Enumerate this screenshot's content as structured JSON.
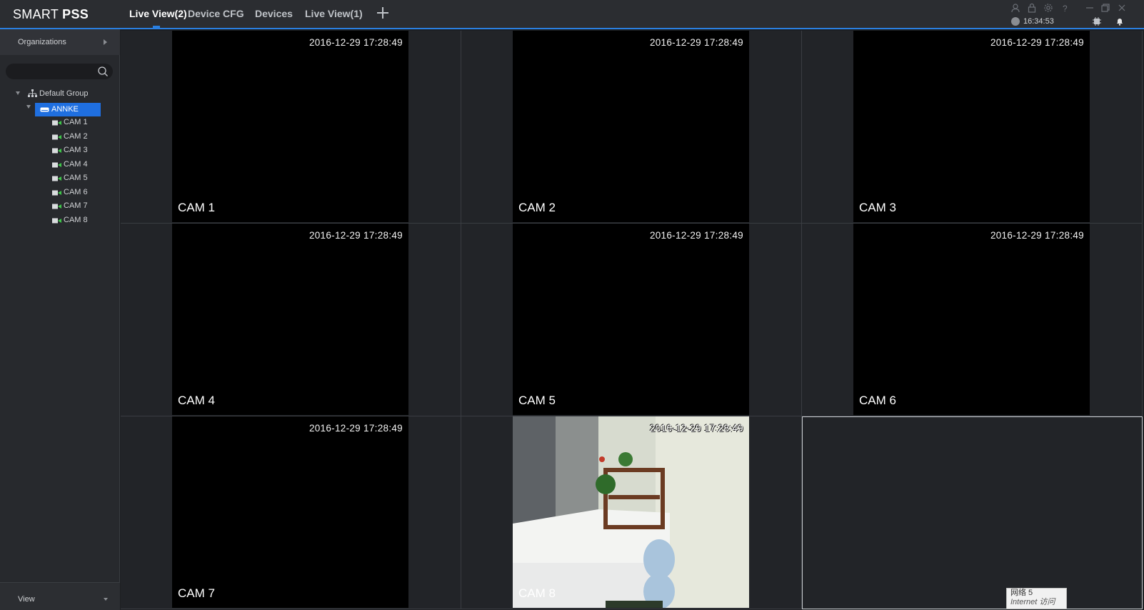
{
  "app": {
    "brand_light": "SMART ",
    "brand_bold": "PSS",
    "clock": "16:34:53"
  },
  "tabs": [
    {
      "label": "Live View(2)",
      "active": true
    },
    {
      "label": "Device CFG",
      "active": false
    },
    {
      "label": "Devices",
      "active": false
    },
    {
      "label": "Live View(1)",
      "active": false
    }
  ],
  "titlebar_icons": [
    "user-icon",
    "lock-icon",
    "settings-icon",
    "help-icon",
    "minimize-icon",
    "restore-icon",
    "close-icon"
  ],
  "sidebar": {
    "organizations_label": "Organizations",
    "search": {
      "placeholder": "",
      "value": ""
    },
    "tree": {
      "group": "Default Group",
      "device": "ANNKE",
      "channels": [
        "CAM 1",
        "CAM 2",
        "CAM 3",
        "CAM 4",
        "CAM 5",
        "CAM 6",
        "CAM 7",
        "CAM 8"
      ]
    },
    "view_label": "View"
  },
  "grid": {
    "cells": [
      {
        "camera": "CAM 1",
        "timestamp": "2016-12-29  17:28:49",
        "feed": "black"
      },
      {
        "camera": "CAM 2",
        "timestamp": "2016-12-29  17:28:49",
        "feed": "black"
      },
      {
        "camera": "CAM 3",
        "timestamp": "2016-12-29  17:28:49",
        "feed": "black"
      },
      {
        "camera": "CAM 4",
        "timestamp": "2016-12-29  17:28:49",
        "feed": "black"
      },
      {
        "camera": "CAM 5",
        "timestamp": "2016-12-29  17:28:49",
        "feed": "black"
      },
      {
        "camera": "CAM 6",
        "timestamp": "2016-12-29  17:28:49",
        "feed": "black"
      },
      {
        "camera": "CAM 7",
        "timestamp": "2016-12-29  17:28:49",
        "feed": "black"
      },
      {
        "camera": "CAM 8",
        "timestamp": "2016-12-29  17:28:49",
        "feed": "live"
      },
      {
        "camera": "",
        "timestamp": "",
        "feed": "empty"
      }
    ]
  },
  "tooltip": {
    "line1": "网络  5",
    "line2": "Internet 访问"
  },
  "colors": {
    "accent": "#2a7fe0",
    "selected": "#1f6fe0",
    "online": "#3fc84a"
  }
}
